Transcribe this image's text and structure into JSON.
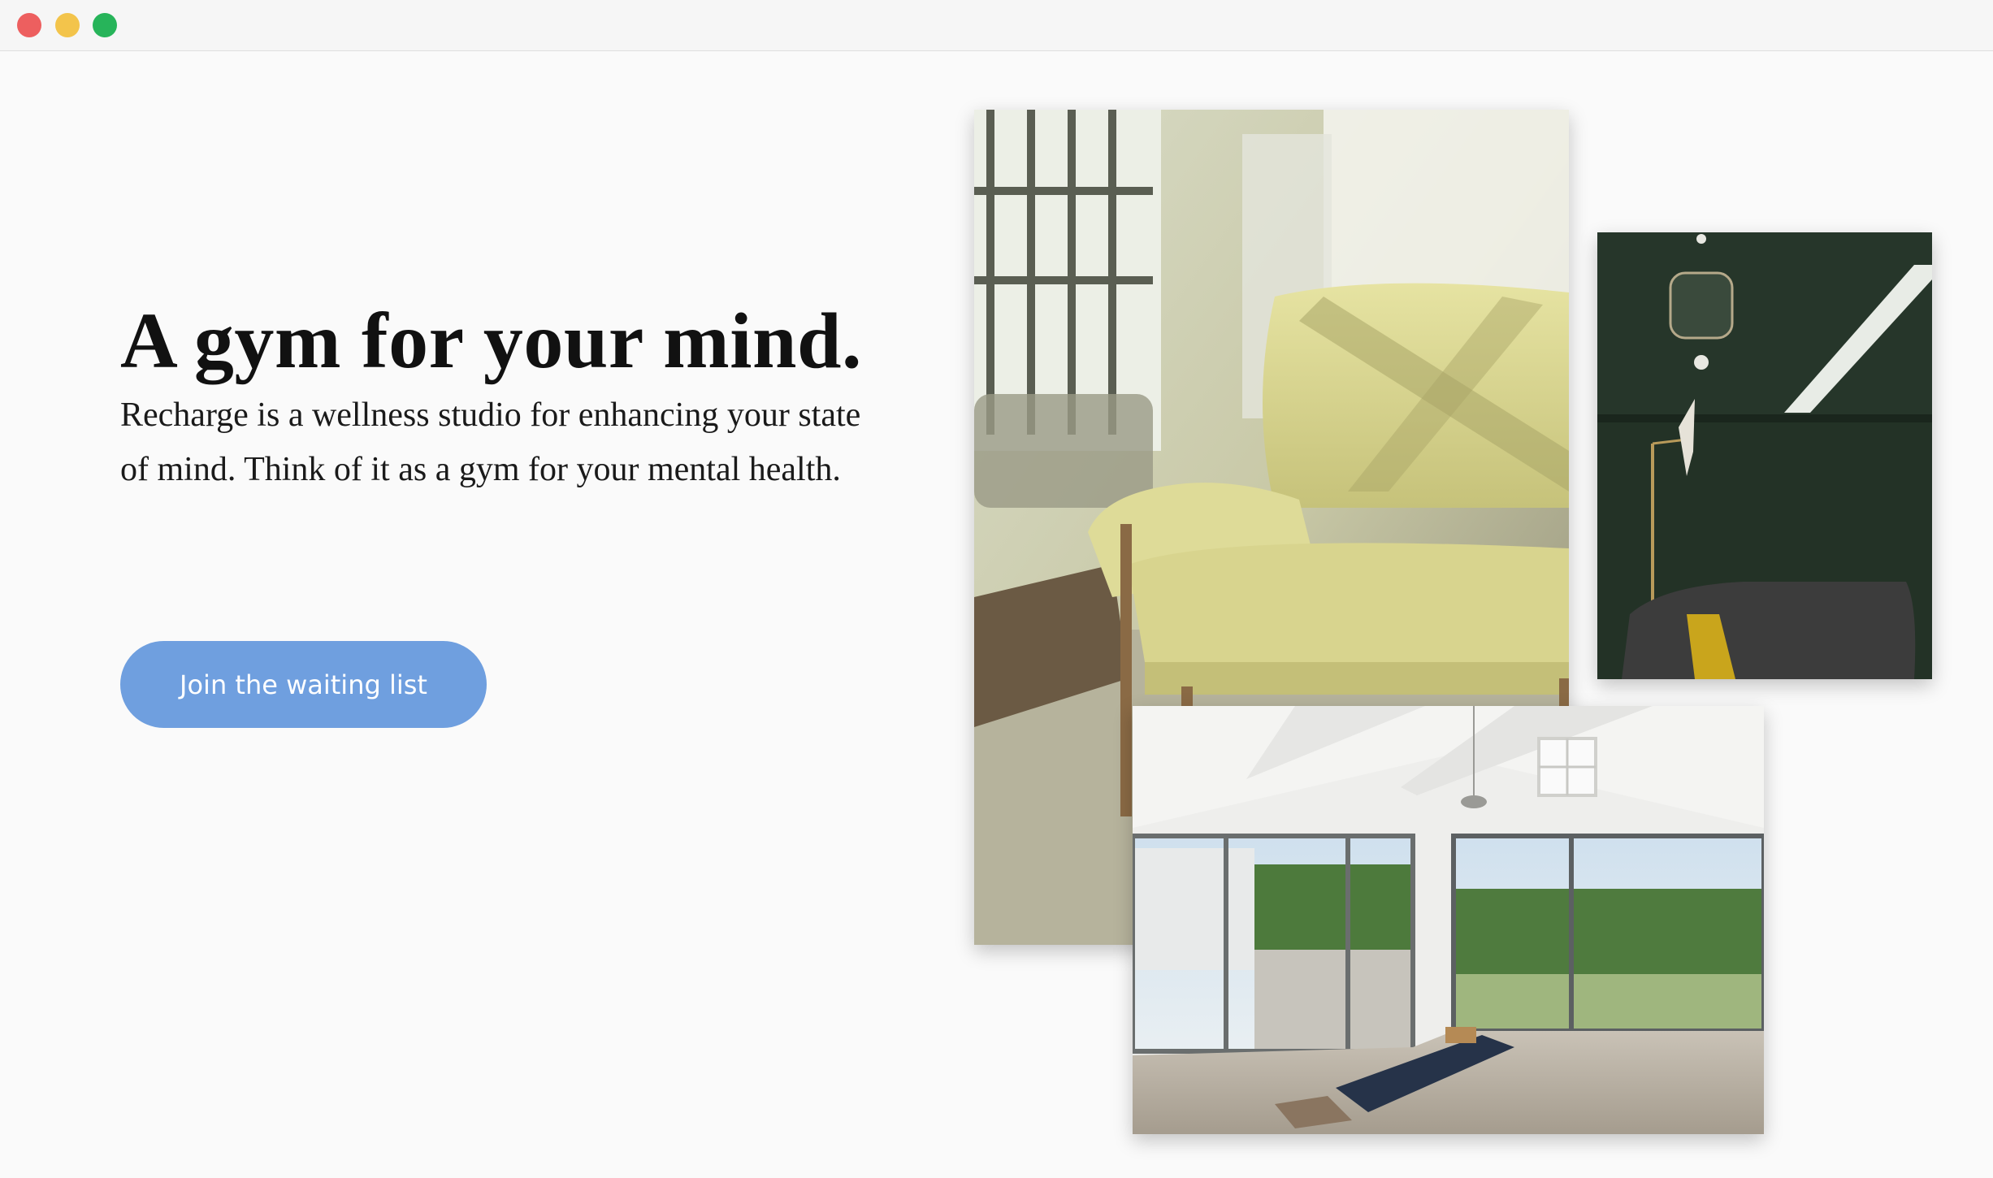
{
  "window": {
    "controls": [
      "close",
      "minimize",
      "maximize"
    ],
    "colors": {
      "close": "#ed5f5f",
      "minimize": "#f3c44b",
      "maximize": "#27b45a"
    }
  },
  "hero": {
    "headline": "A gym for your mind.",
    "description": "Recharge is a wellness studio for enhancing your state of mind. Think of it as a gym for your mental health.",
    "cta_label": "Join the waiting list"
  },
  "images": [
    {
      "id": "armchair",
      "alt": "Yellow-green leather armchair in a sunlit studio"
    },
    {
      "id": "green-room",
      "alt": "Dark green room with a bird lamp and mirror"
    },
    {
      "id": "yoga-room",
      "alt": "Bright yoga room with a mat and large windows"
    }
  ],
  "colors": {
    "background": "#fafafa",
    "button": "#6f9fdf",
    "button_text": "#ffffff",
    "headline": "#111111"
  }
}
